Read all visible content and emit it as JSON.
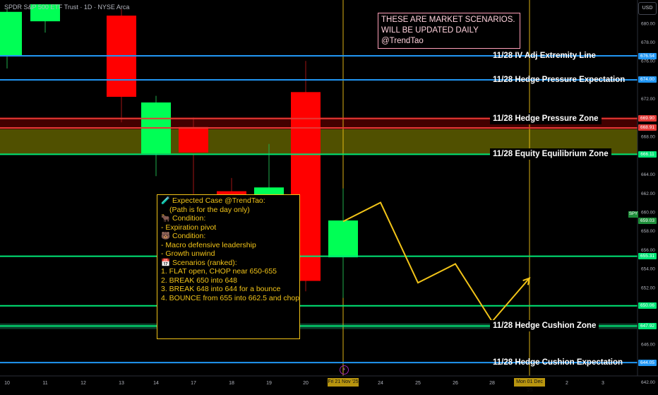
{
  "header": {
    "symbol_legend": "SPDR S&P 500 ETF Trust · 1D · NYSE Arca"
  },
  "notice": {
    "line1": "THESE ARE MARKET SCENARIOS.",
    "line2": "WILL BE UPDATED DAILY @TrendTao"
  },
  "axis_button": "USD",
  "spy_tag": "SPY",
  "scenario_box": {
    "title_icon": "test-tube-icon",
    "title": "Expected Case @TrendTao:",
    "subtitle": "(Path is for the day only)",
    "bull_icon": "bull-icon",
    "bull_heading": "Condition:",
    "bull_item": "- Expiration pivot",
    "bear_icon": "bear-icon",
    "bear_heading": "Condition:",
    "bear_items": [
      "- Macro defensive leadership",
      "- Growth unwind"
    ],
    "calendar_icon": "calendar-icon",
    "scenarios_heading": "Scenarios (ranked):",
    "scenarios": [
      "1. FLAT open, CHOP near 650-655",
      "2. BREAK 650 into 648",
      "3. BREAK 648 into 644 for a bounce",
      "4. BOUNCE from 655 into 662.5 and chop"
    ]
  },
  "date_tags": [
    "Fri 21 Nov '25",
    "Mon 01 Dec '25"
  ],
  "colors": {
    "background": "#000000",
    "bull_candle": "#00ff55",
    "bear_candle": "#ff0000",
    "blue_line": "#2196f3",
    "green_line": "#00e676",
    "red_line": "#e53935",
    "path": "#f2c418",
    "equilibrium_zone": "#6b6b00"
  },
  "chart_data": {
    "type": "candlestick",
    "y_axis": {
      "ylim": [
        641,
        682
      ],
      "ticks": [
        642,
        644,
        646,
        648,
        650,
        652,
        654,
        656,
        658,
        660,
        662,
        664,
        666,
        668,
        670,
        672,
        674,
        676,
        678,
        680
      ]
    },
    "x_axis": {
      "tick_labels": [
        "10",
        "11",
        "12",
        "13",
        "14",
        "17",
        "18",
        "19",
        "20",
        "Fri 21 Nov '25",
        "24",
        "25",
        "26",
        "28",
        "Mon 01 Dec '25",
        "2",
        "3"
      ]
    },
    "candles": [
      {
        "date": "10",
        "open": 676.5,
        "high": 681.5,
        "low": 675.2,
        "close": 681.2
      },
      {
        "date": "11",
        "open": 680.2,
        "high": 682.0,
        "low": 679.0,
        "close": 682.0
      },
      {
        "date": "13",
        "open": 680.8,
        "high": 681.5,
        "low": 669.5,
        "close": 672.2
      },
      {
        "date": "14",
        "open": 666.2,
        "high": 672.3,
        "low": 663.8,
        "close": 671.6
      },
      {
        "date": "17",
        "open": 669.0,
        "high": 670.0,
        "low": 661.8,
        "close": 666.3
      },
      {
        "date": "18",
        "open": 662.2,
        "high": 663.6,
        "low": 655.0,
        "close": 661.0
      },
      {
        "date": "19",
        "open": 660.5,
        "high": 667.2,
        "low": 656.5,
        "close": 662.6
      },
      {
        "date": "20",
        "open": 672.7,
        "high": 676.0,
        "low": 651.6,
        "close": 652.7
      },
      {
        "date": "Fri 21 Nov '25",
        "open": 655.2,
        "high": 662.5,
        "low": 650.9,
        "close": 659.1
      }
    ],
    "levels": [
      {
        "label": "11/28 IV Adj Extremity Line",
        "value": 676.54,
        "tag": "676.54",
        "color": "#2196f3"
      },
      {
        "label": "11/28 Hedge Pressure Expectation",
        "value": 674.0,
        "tag": "674.00",
        "color": "#2196f3"
      },
      {
        "label": "11/28 Hedge Pressure Zone",
        "value": 669.9,
        "tag": "669.90",
        "color": "#e53935"
      },
      {
        "label": "",
        "value": 668.91,
        "tag": "668.91",
        "color": "#e53935"
      },
      {
        "label": "11/28 Equity Equilibrium Zone",
        "value": 666.11,
        "tag": "666.11",
        "color": "#00e676"
      },
      {
        "label": "",
        "value": 655.31,
        "tag": "655.31",
        "color": "#00e676"
      },
      {
        "label": "",
        "value": 650.06,
        "tag": "650.06",
        "color": "#00e676"
      },
      {
        "label": "11/28 Hedge Cushion Zone",
        "value": 647.92,
        "tag": "647.92",
        "color": "#00e676"
      },
      {
        "label": "11/28 Hedge Cushion Expectation",
        "value": 644.05,
        "tag": "644.05",
        "color": "#2196f3"
      }
    ],
    "current_price": {
      "value": 659.03,
      "tag": "659.03"
    },
    "projected_path": [
      {
        "x": "Fri 21 Nov '25",
        "y": 659.0
      },
      {
        "x": "24",
        "y": 661.0
      },
      {
        "x": "25",
        "y": 652.5
      },
      {
        "x": "26",
        "y": 654.5
      },
      {
        "x": "28",
        "y": 648.4
      },
      {
        "x": "Mon 01 Dec '25",
        "y": 653.0
      }
    ],
    "vertical_markers": [
      "Fri 21 Nov '25",
      "Mon 01 Dec '25"
    ]
  }
}
